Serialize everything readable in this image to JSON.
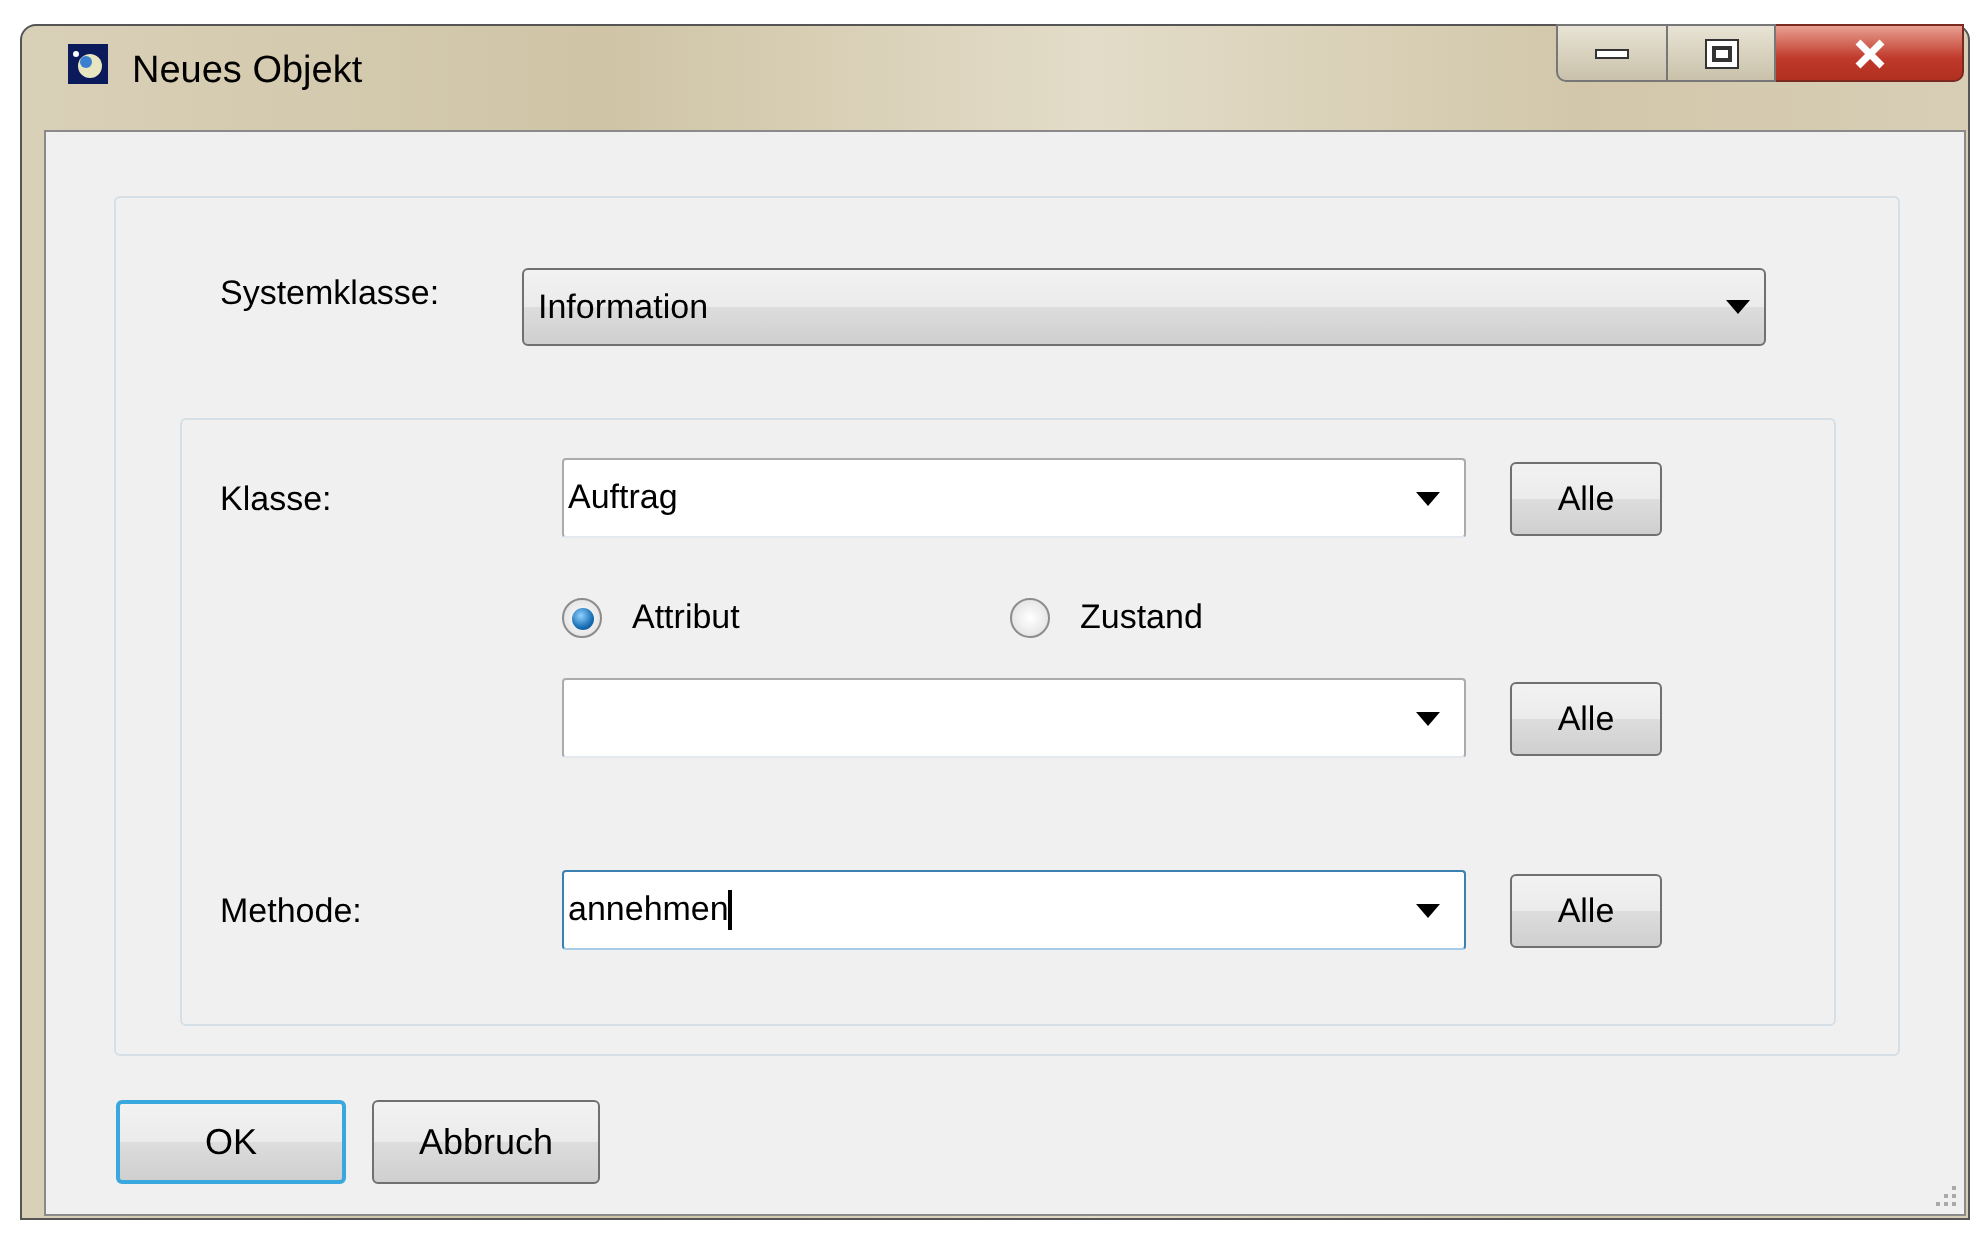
{
  "window": {
    "title": "Neues Objekt"
  },
  "systemklasse": {
    "label": "Systemklasse:",
    "value": "Information"
  },
  "klasse": {
    "label": "Klasse:",
    "value": "Auftrag",
    "button": "Alle"
  },
  "mode": [
    {
      "label": "Attribut",
      "selected": true
    },
    {
      "label": "Zustand",
      "selected": false
    }
  ],
  "attribute_field": {
    "button": "Alle"
  },
  "methode": {
    "label": "Methode:",
    "value": "annehmen",
    "focused": true,
    "button": "Alle"
  },
  "buttons": [
    {
      "label": "OK",
      "default": true
    },
    {
      "label": "Abbruch",
      "default": false
    }
  ]
}
